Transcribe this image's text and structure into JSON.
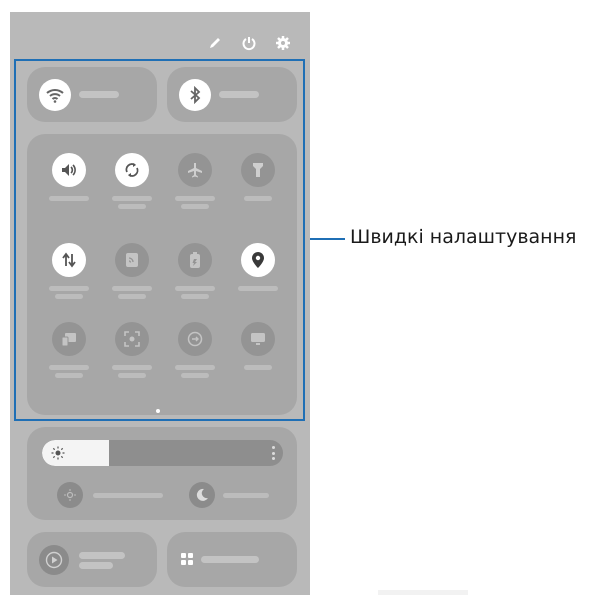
{
  "annotation": {
    "label": "Швидкі налаштування",
    "color": "#1f6fb5"
  },
  "top_bar": {
    "icons": [
      "pencil-icon",
      "power-icon",
      "gear-icon"
    ]
  },
  "large_tiles": [
    {
      "icon": "wifi-icon",
      "state": "on"
    },
    {
      "icon": "bluetooth-icon",
      "state": "on"
    }
  ],
  "quick_tiles": [
    {
      "icon": "sound-icon",
      "state": "on"
    },
    {
      "icon": "auto-rotate-icon",
      "state": "on"
    },
    {
      "icon": "airplane-icon",
      "state": "off"
    },
    {
      "icon": "flashlight-icon",
      "state": "off"
    },
    {
      "icon": "mobile-data-icon",
      "state": "on"
    },
    {
      "icon": "nfc-icon",
      "state": "off"
    },
    {
      "icon": "power-saving-icon",
      "state": "off"
    },
    {
      "icon": "location-icon",
      "state": "on"
    },
    {
      "icon": "link-to-windows-icon",
      "state": "off"
    },
    {
      "icon": "screen-recorder-icon",
      "state": "off"
    },
    {
      "icon": "quick-share-icon",
      "state": "off"
    },
    {
      "icon": "dex-icon",
      "state": "off"
    }
  ],
  "brightness": {
    "level_fraction": 0.28,
    "icon": "sun-icon"
  },
  "bottom_tiles": [
    {
      "icon": "media-play-icon"
    },
    {
      "icon": "device-control-icon"
    }
  ],
  "colors": {
    "panel_bg": "#b9b9b9",
    "tile_bg": "#a7a7a7",
    "tile_on": "#ffffff",
    "tile_off": "#949494"
  }
}
